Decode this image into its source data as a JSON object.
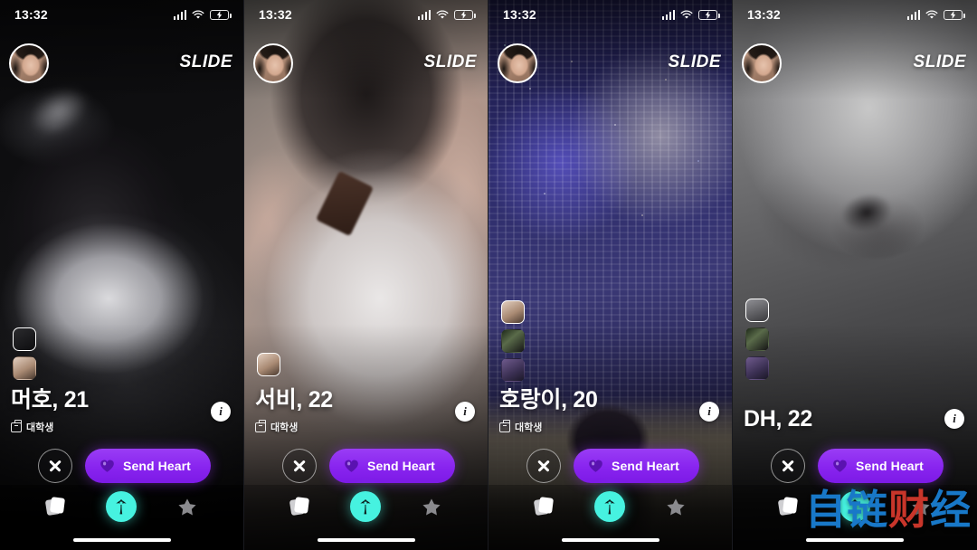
{
  "app": {
    "name": "SLIDE",
    "brand_label": "SLIDE",
    "accent_purple": "#8824ef",
    "accent_cyan": "#46f2e0"
  },
  "status_bar": {
    "time": "13:32",
    "icons": [
      "signal-icon",
      "wifi-icon",
      "battery-charging-icon"
    ]
  },
  "buttons": {
    "pass_label": "",
    "send_heart_label": "Send Heart",
    "info_label": "i"
  },
  "nav": {
    "items": [
      {
        "name": "cards",
        "icon": "stacked-cards-icon",
        "active": false
      },
      {
        "name": "discover",
        "icon": "palm-tree-icon",
        "active": true
      },
      {
        "name": "favorites",
        "icon": "star-icon",
        "active": false
      }
    ]
  },
  "watermark": {
    "text_part1": "自",
    "text_part2": "链",
    "text_part3": "财",
    "text_part4": "经"
  },
  "panels": [
    {
      "id": "panel-1",
      "time": "13:32",
      "brand": "SLIDE",
      "profile_name": "머호, 21",
      "tag_label": "대학생",
      "info_label": "i",
      "send_heart_label": "Send Heart",
      "thumb_count": 2,
      "active_thumb": 0
    },
    {
      "id": "panel-2",
      "time": "13:32",
      "brand": "SLIDE",
      "profile_name": "서비, 22",
      "tag_label": "대학생",
      "info_label": "i",
      "send_heart_label": "Send Heart",
      "thumb_count": 1,
      "active_thumb": 0
    },
    {
      "id": "panel-3",
      "time": "13:32",
      "brand": "SLIDE",
      "profile_name": "호랑이, 20",
      "tag_label": "대학생",
      "info_label": "i",
      "send_heart_label": "Send Heart",
      "thumb_count": 3,
      "active_thumb": 0
    },
    {
      "id": "panel-4",
      "time": "13:32",
      "brand": "SLIDE",
      "profile_name": "DH, 22",
      "tag_label": "",
      "info_label": "i",
      "send_heart_label": "Send Heart",
      "thumb_count": 3,
      "active_thumb": 0
    }
  ]
}
